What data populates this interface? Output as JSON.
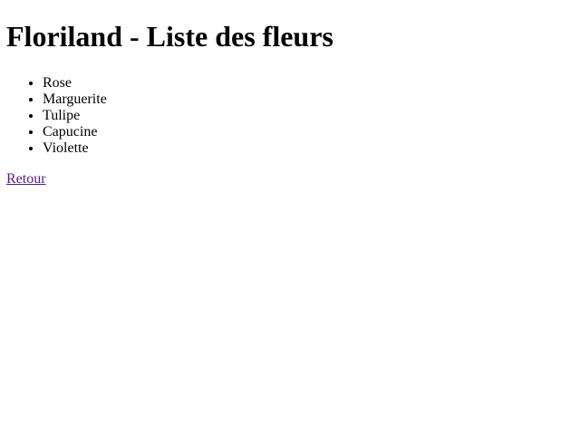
{
  "page": {
    "title": "Floriland - Liste des fleurs"
  },
  "flowers": [
    {
      "label": "Rose"
    },
    {
      "label": "Marguerite"
    },
    {
      "label": "Tulipe"
    },
    {
      "label": "Capucine"
    },
    {
      "label": "Violette"
    }
  ],
  "nav": {
    "back_label": "Retour"
  },
  "colors": {
    "link_visited": "#551a8b",
    "text": "#000000",
    "background": "#ffffff"
  }
}
